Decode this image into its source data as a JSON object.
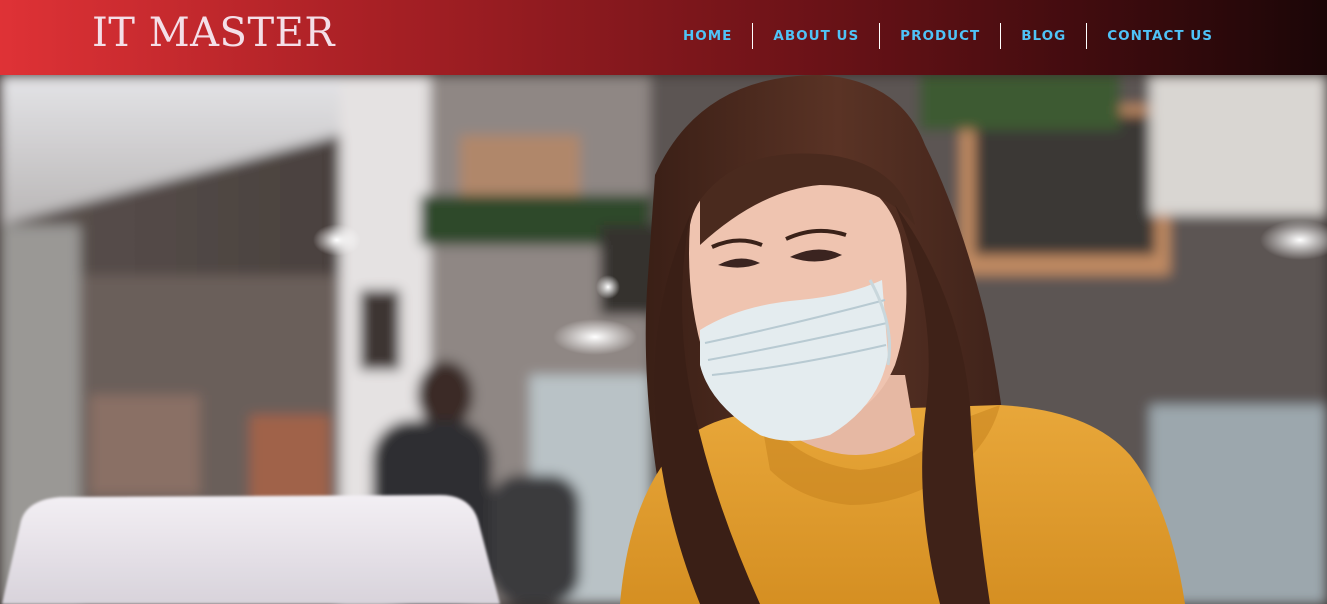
{
  "header": {
    "logo_text": "IT MASTER",
    "background_colors": [
      "#df3236",
      "#a82025",
      "#6a1217",
      "#1b0607"
    ],
    "logo_color": "#f4dfe8",
    "nav_color": "#4fc3f7"
  },
  "nav": {
    "items": [
      {
        "label": "HOME"
      },
      {
        "label": "ABOUT US"
      },
      {
        "label": "PRODUCT"
      },
      {
        "label": "BLOG"
      },
      {
        "label": "CONTACT US"
      }
    ]
  },
  "hero": {
    "image": "woman-wearing-face-mask-working-on-laptop-in-cafe"
  }
}
